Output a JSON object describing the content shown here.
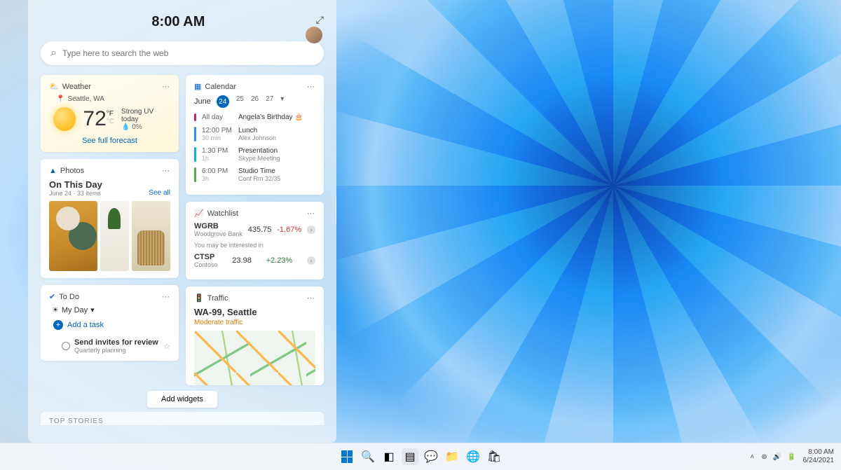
{
  "panel": {
    "time": "8:00 AM",
    "search_placeholder": "Type here to search the web"
  },
  "weather": {
    "title": "Weather",
    "location": "Seattle, WA",
    "temp": "72",
    "unit_f": "°F",
    "unit_c": "°C",
    "uv": "Strong UV today",
    "precip_icon": "💧",
    "precip": "0%",
    "forecast_link": "See full forecast"
  },
  "photos": {
    "title": "Photos",
    "heading": "On This Day",
    "meta": "June 24 · 33 items",
    "see_all": "See all"
  },
  "todo": {
    "title": "To Do",
    "myday": "My Day",
    "add_task": "Add a task",
    "task_title": "Send invites for review",
    "task_sub": "Quarterly planning"
  },
  "calendar": {
    "title": "Calendar",
    "month": "June",
    "days": [
      "24",
      "25",
      "26",
      "27"
    ],
    "events": [
      {
        "bar": "e-magenta",
        "time": "All day",
        "dur": "",
        "title": "Angela's Birthday 🎂",
        "sub": ""
      },
      {
        "bar": "e-blue",
        "time": "12:00 PM",
        "dur": "30 min",
        "title": "Lunch",
        "sub": "Alex Johnson"
      },
      {
        "bar": "e-teal",
        "time": "1:30 PM",
        "dur": "1h",
        "title": "Presentation",
        "sub": "Skype Meeting"
      },
      {
        "bar": "e-green",
        "time": "6:00 PM",
        "dur": "3h",
        "title": "Studio Time",
        "sub": "Conf Rm 32/35"
      }
    ]
  },
  "watchlist": {
    "title": "Watchlist",
    "interest_label": "You may be interested in",
    "stocks": [
      {
        "sym": "WGRB",
        "name": "Woodgrove Bank",
        "price": "435.75",
        "chg": "-1.67%",
        "dir": "neg",
        "drill": true
      },
      {
        "sym": "CTSP",
        "name": "Contoso",
        "price": "23.98",
        "chg": "+2.23%",
        "dir": "pos",
        "drill": true
      }
    ]
  },
  "traffic": {
    "title": "Traffic",
    "route": "WA-99, Seattle",
    "status": "Moderate traffic"
  },
  "add_widgets": "Add widgets",
  "top_stories": "TOP STORIES",
  "taskbar": {
    "time": "8:00 AM",
    "date": "6/24/2021"
  }
}
